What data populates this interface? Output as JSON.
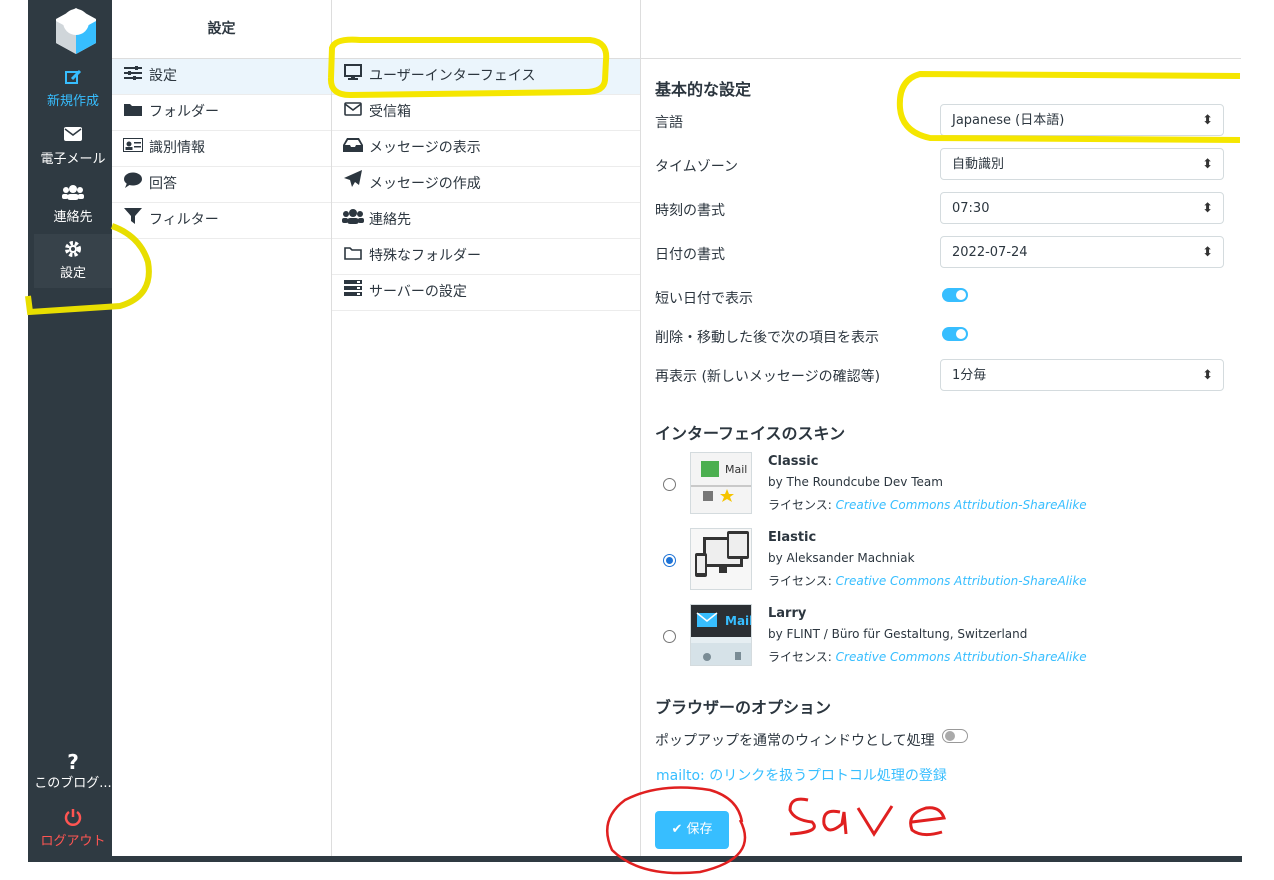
{
  "nav": {
    "compose": "新規作成",
    "mail": "電子メール",
    "contacts": "連絡先",
    "settings": "設定",
    "about": "このブログ...",
    "logout": "ログアウト"
  },
  "settings_menu": {
    "header": "設定",
    "items": [
      {
        "label": "設定",
        "icon": "sliders-icon"
      },
      {
        "label": "フォルダー",
        "icon": "folder-icon"
      },
      {
        "label": "識別情報",
        "icon": "id-card-icon"
      },
      {
        "label": "回答",
        "icon": "comment-icon"
      },
      {
        "label": "フィルター",
        "icon": "filter-icon"
      }
    ]
  },
  "sections": {
    "items": [
      {
        "label": "ユーザーインターフェイス",
        "icon": "monitor-icon"
      },
      {
        "label": "受信箱",
        "icon": "envelope-icon"
      },
      {
        "label": "メッセージの表示",
        "icon": "inbox-icon"
      },
      {
        "label": "メッセージの作成",
        "icon": "paper-plane-icon"
      },
      {
        "label": "連絡先",
        "icon": "users-icon"
      },
      {
        "label": "特殊なフォルダー",
        "icon": "folder-outline-icon"
      },
      {
        "label": "サーバーの設定",
        "icon": "server-icon"
      }
    ]
  },
  "prefs": {
    "basic_title": "基本的な設定",
    "language_label": "言語",
    "language_value": "Japanese (日本語)",
    "timezone_label": "タイムゾーン",
    "timezone_value": "自動識別",
    "time_format_label": "時刻の書式",
    "time_format_value": "07:30",
    "date_format_label": "日付の書式",
    "date_format_value": "2022-07-24",
    "short_date_label": "短い日付で表示",
    "short_date_on": true,
    "next_item_label": "削除・移動した後で次の項目を表示",
    "next_item_on": true,
    "refresh_label": "再表示 (新しいメッセージの確認等)",
    "refresh_value": "1分毎",
    "skin_title": "インターフェイスのスキン",
    "license_prefix": "ライセンス:",
    "skins": [
      {
        "name": "Classic",
        "by": "by The Roundcube Dev Team",
        "license": "Creative Commons Attribution-ShareAlike",
        "selected": false
      },
      {
        "name": "Elastic",
        "by": "by Aleksander Machniak",
        "license": "Creative Commons Attribution-ShareAlike",
        "selected": true
      },
      {
        "name": "Larry",
        "by": "by FLINT / Büro für Gestaltung, Switzerland",
        "license": "Creative Commons Attribution-ShareAlike",
        "selected": false
      }
    ],
    "browser_title": "ブラウザーのオプション",
    "popup_label": "ポップアップを通常のウィンドウとして処理",
    "popup_on": false,
    "mailto_link": "mailto: のリンクを扱うプロトコル処理の登録",
    "save_label": "保存"
  },
  "annotation": {
    "handwritten_text": "save",
    "highlight_color": "#f5e600",
    "ink_color": "#e02020"
  },
  "thumb_text": {
    "classic_mail": "Mail",
    "larry_mail": "Mail"
  },
  "colors": {
    "nav_bg": "#2f3a42",
    "accent": "#37beff",
    "logout": "#ff5552"
  }
}
